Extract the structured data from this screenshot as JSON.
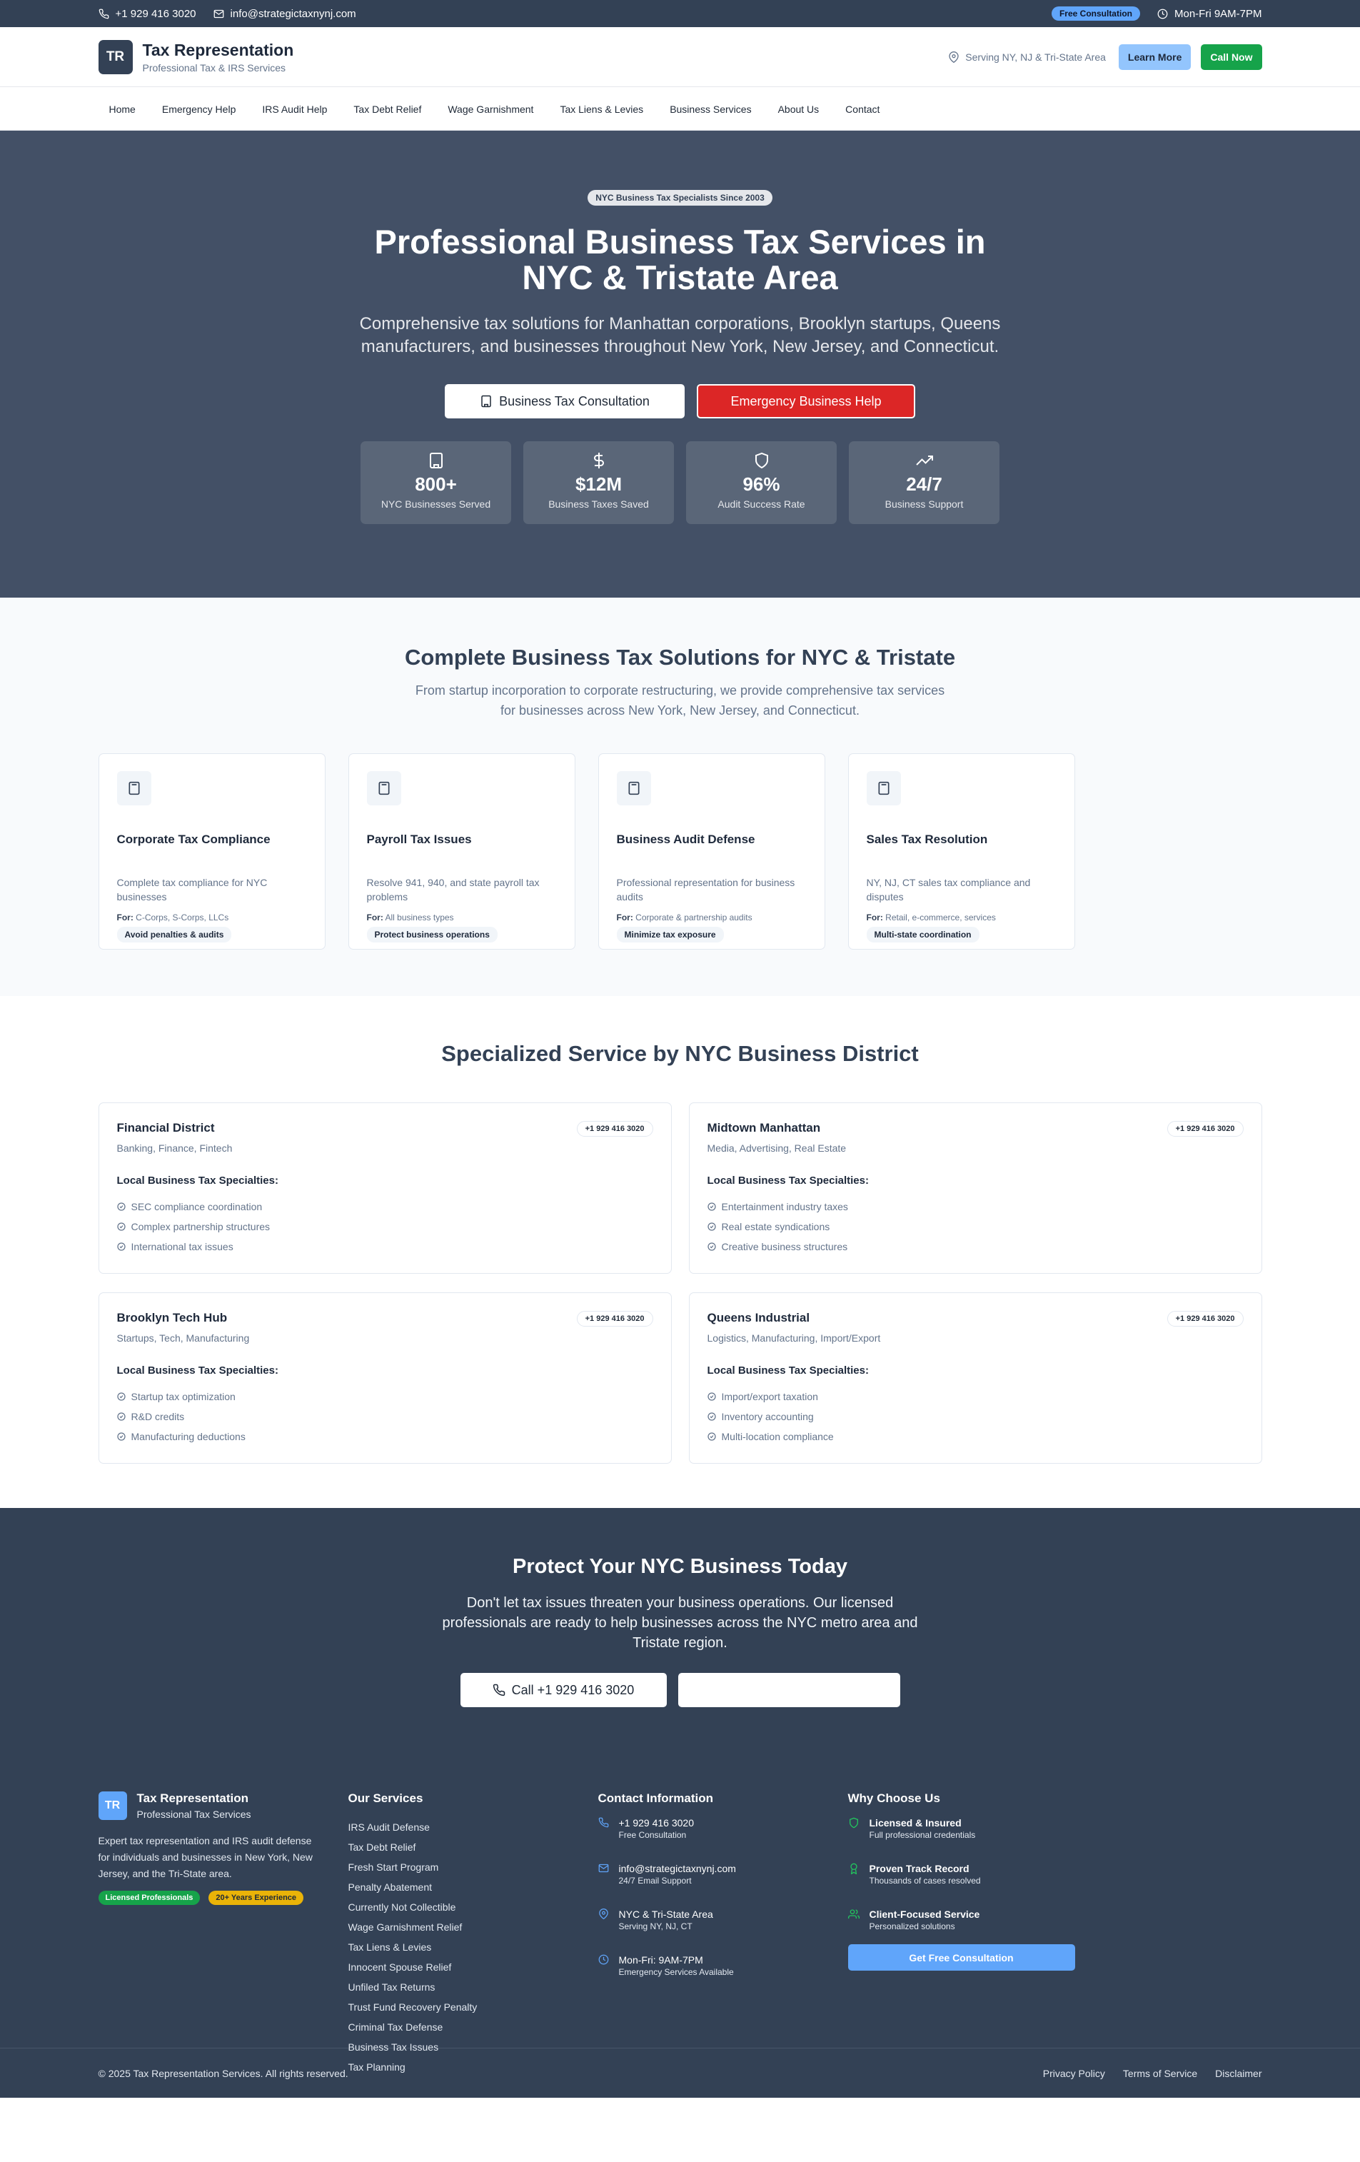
{
  "topbar": {
    "phone": "+1 929 416 3020",
    "email": "info@strategictaxnynj.com",
    "badge": "Free Consultation",
    "hours": "Mon-Fri 9AM-7PM"
  },
  "header": {
    "logo": "TR",
    "title": "Tax Representation",
    "subtitle": "Professional Tax & IRS Services",
    "serving": "Serving NY, NJ & Tri-State Area",
    "learn_more": "Learn More",
    "call_now": "Call Now"
  },
  "nav": {
    "items": [
      {
        "label": "Home"
      },
      {
        "label": "Emergency Help"
      },
      {
        "label": "IRS Audit Help"
      },
      {
        "label": "Tax Debt Relief"
      },
      {
        "label": "Wage Garnishment"
      },
      {
        "label": "Tax Liens & Levies"
      },
      {
        "label": "Business Services"
      },
      {
        "label": "About Us"
      },
      {
        "label": "Contact"
      }
    ]
  },
  "hero": {
    "badge": "NYC Business Tax Specialists Since 2003",
    "title": "Professional Business Tax Services in NYC & Tristate Area",
    "subtitle": "Comprehensive tax solutions for Manhattan corporations, Brooklyn startups, Queens manufacturers, and businesses throughout New York, New Jersey, and Connecticut.",
    "btn_consult": "Business Tax Consultation",
    "btn_emergency": "Emergency Business Help",
    "stats": [
      {
        "icon": "building-icon",
        "value": "800+",
        "label": "NYC Businesses Served"
      },
      {
        "icon": "dollar-icon",
        "value": "$12M",
        "label": "Business Taxes Saved"
      },
      {
        "icon": "shield-icon",
        "value": "96%",
        "label": "Audit Success Rate"
      },
      {
        "icon": "trending-up-icon",
        "value": "24/7",
        "label": "Business Support"
      }
    ]
  },
  "solutions": {
    "title": "Complete Business Tax Solutions for NYC & Tristate",
    "subtitle": "From startup incorporation to corporate restructuring, we provide comprehensive tax services for businesses across New York, New Jersey, and Connecticut.",
    "for_label": "For:",
    "cards": [
      {
        "icon": "calculator-icon",
        "title": "Corporate Tax Compliance",
        "desc": "Complete tax compliance for NYC businesses",
        "for": "C-Corps, S-Corps, LLCs",
        "tag": "Avoid penalties & audits"
      },
      {
        "icon": "calculator-icon",
        "title": "Payroll Tax Issues",
        "desc": "Resolve 941, 940, and state payroll tax problems",
        "for": "All business types",
        "tag": "Protect business operations"
      },
      {
        "icon": "calculator-icon",
        "title": "Business Audit Defense",
        "desc": "Professional representation for business audits",
        "for": "Corporate & partnership audits",
        "tag": "Minimize tax exposure"
      },
      {
        "icon": "calculator-icon",
        "title": "Sales Tax Resolution",
        "desc": "NY, NJ, CT sales tax compliance and disputes",
        "for": "Retail, e-commerce, services",
        "tag": "Multi-state coordination"
      }
    ]
  },
  "districts": {
    "title": "Specialized Service by NYC Business District",
    "spec_label": "Local Business Tax Specialties:",
    "items": [
      {
        "name": "Financial District",
        "phone": "+1 929 416 3020",
        "industries": "Banking, Finance, Fintech",
        "specialties": [
          "SEC compliance coordination",
          "Complex partnership structures",
          "International tax issues"
        ]
      },
      {
        "name": "Midtown Manhattan",
        "phone": "+1 929 416 3020",
        "industries": "Media, Advertising, Real Estate",
        "specialties": [
          "Entertainment industry taxes",
          "Real estate syndications",
          "Creative business structures"
        ]
      },
      {
        "name": "Brooklyn Tech Hub",
        "phone": "+1 929 416 3020",
        "industries": "Startups, Tech, Manufacturing",
        "specialties": [
          "Startup tax optimization",
          "R&D credits",
          "Manufacturing deductions"
        ]
      },
      {
        "name": "Queens Industrial",
        "phone": "+1 929 416 3020",
        "industries": "Logistics, Manufacturing, Import/Export",
        "specialties": [
          "Import/export taxation",
          "Inventory accounting",
          "Multi-location compliance"
        ]
      }
    ]
  },
  "cta": {
    "title": "Protect Your NYC Business Today",
    "subtitle": "Don't let tax issues threaten your business operations. Our licensed professionals are ready to help businesses across the NYC metro area and Tristate region.",
    "call": "Call +1 929 416 3020"
  },
  "footer": {
    "logo": "TR",
    "title": "Tax Representation",
    "subtitle": "Professional Tax Services",
    "desc": "Expert tax representation and IRS audit defense for individuals and businesses in New York, New Jersey, and the Tri-State area.",
    "badge1": "Licensed Professionals",
    "badge2": "20+ Years Experience",
    "badge1_color": "#16a34a",
    "badge2_color": "#eab308",
    "services_title": "Our Services",
    "services": [
      {
        "label": "IRS Audit Defense"
      },
      {
        "label": "Tax Debt Relief"
      },
      {
        "label": "Fresh Start Program"
      },
      {
        "label": "Penalty Abatement"
      },
      {
        "label": "Currently Not Collectible"
      },
      {
        "label": "Wage Garnishment Relief"
      },
      {
        "label": "Tax Liens & Levies"
      },
      {
        "label": "Innocent Spouse Relief"
      },
      {
        "label": "Unfiled Tax Returns"
      },
      {
        "label": "Trust Fund Recovery Penalty"
      },
      {
        "label": "Criminal Tax Defense"
      },
      {
        "label": "Business Tax Issues"
      },
      {
        "label": "Tax Planning"
      }
    ],
    "contact_title": "Contact Information",
    "contacts": [
      {
        "icon": "phone-icon",
        "main": "+1 929 416 3020",
        "sub": "Free Consultation"
      },
      {
        "icon": "mail-icon",
        "main": "info@strategictaxnynj.com",
        "sub": "24/7 Email Support"
      },
      {
        "icon": "map-pin-icon",
        "main": "NYC & Tri-State Area",
        "sub": "Serving NY, NJ, CT"
      },
      {
        "icon": "clock-icon",
        "main": "Mon-Fri: 9AM-7PM",
        "sub": "Emergency Services Available"
      }
    ],
    "why_title": "Why Choose Us",
    "why": [
      {
        "icon": "shield-icon",
        "title": "Licensed & Insured",
        "sub": "Full professional credentials"
      },
      {
        "icon": "award-icon",
        "title": "Proven Track Record",
        "sub": "Thousands of cases resolved"
      },
      {
        "icon": "users-icon",
        "title": "Client-Focused Service",
        "sub": "Personalized solutions"
      }
    ],
    "cta_btn": "Get Free Consultation",
    "copyright": "© 2025 Tax Representation Services. All rights reserved.",
    "legal": [
      {
        "label": "Privacy Policy"
      },
      {
        "label": "Terms of Service"
      },
      {
        "label": "Disclaimer"
      }
    ]
  },
  "colors": {
    "primary": "#334155",
    "hero_bg": "#435066",
    "accent_blue": "#60a5fa",
    "emergency_red": "#dc2626",
    "call_green": "#16a34a"
  }
}
